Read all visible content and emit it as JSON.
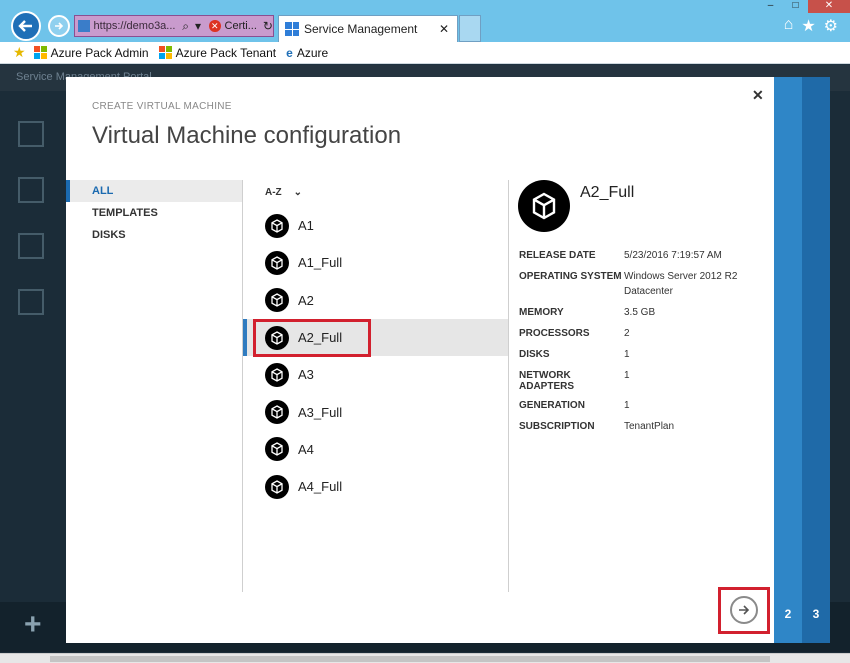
{
  "browser": {
    "address_url": "https://demo3a...",
    "cert_label": "Certi...",
    "tab_title": "Service Management",
    "favorites": [
      {
        "label": "Azure Pack Admin",
        "icon": "microsoft-icon"
      },
      {
        "label": "Azure Pack Tenant",
        "icon": "microsoft-icon"
      },
      {
        "label": "Azure",
        "icon": "ie-icon"
      }
    ]
  },
  "portal": {
    "title": "Service Management Portal"
  },
  "wizard": {
    "kicker": "CREATE VIRTUAL MACHINE",
    "title": "Virtual Machine configuration",
    "filters": [
      "ALL",
      "TEMPLATES",
      "DISKS"
    ],
    "active_filter": "ALL",
    "sort_label": "A-Z",
    "items": [
      "A1",
      "A1_Full",
      "A2",
      "A2_Full",
      "A3",
      "A3_Full",
      "A4",
      "A4_Full"
    ],
    "selected": "A2_Full",
    "steps": [
      "2",
      "3"
    ]
  },
  "detail": {
    "name": "A2_Full",
    "props": [
      {
        "key": "RELEASE DATE",
        "value": "5/23/2016 7:19:57 AM"
      },
      {
        "key": "OPERATING SYSTEM",
        "value": "Windows Server 2012 R2 Datacenter"
      },
      {
        "key": "MEMORY",
        "value": "3.5 GB"
      },
      {
        "key": "PROCESSORS",
        "value": "2"
      },
      {
        "key": "DISKS",
        "value": "1"
      },
      {
        "key": "NETWORK ADAPTERS",
        "value": "1"
      },
      {
        "key": "GENERATION",
        "value": "1"
      },
      {
        "key": "SUBSCRIPTION",
        "value": "TenantPlan"
      }
    ]
  },
  "colors": {
    "accent": "#1b6ab0",
    "highlight": "#d2202e",
    "step2": "#2f86c7",
    "step3": "#1f6aa8"
  }
}
